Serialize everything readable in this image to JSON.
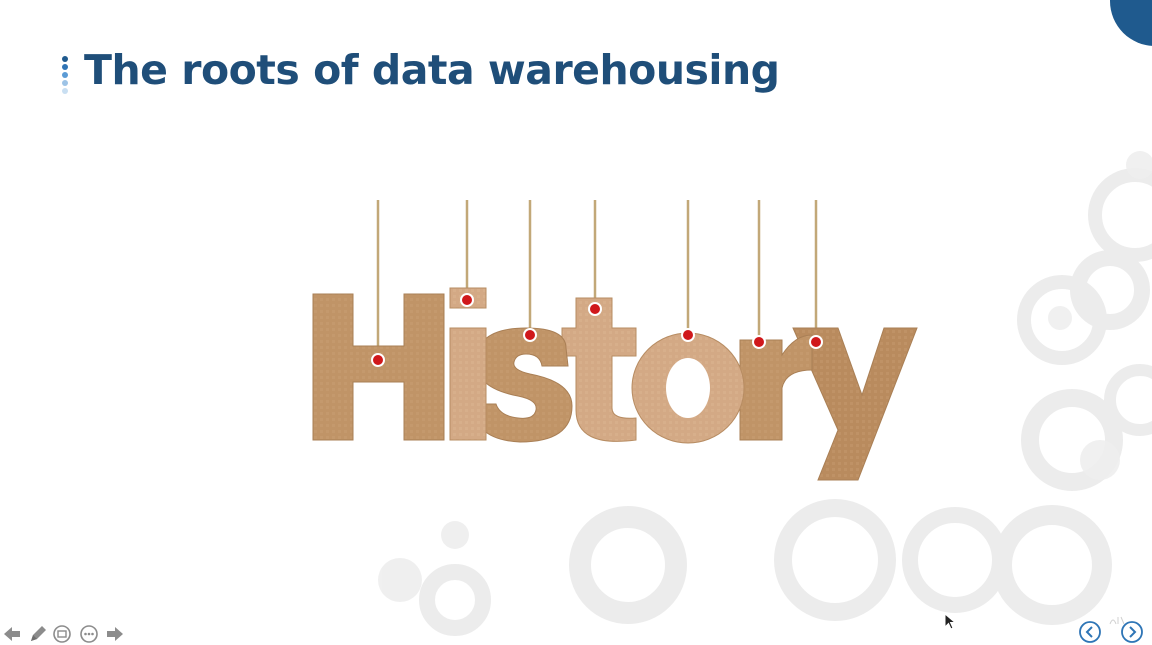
{
  "slide": {
    "title": "The roots of data warehousing",
    "graphic": {
      "word": "History",
      "letters": [
        "H",
        "i",
        "s",
        "t",
        "o",
        "r",
        "y"
      ]
    }
  },
  "icons": {
    "title_bullets": "vertical-dots-icon",
    "toolbar": [
      "arrow-left-icon",
      "pen-icon",
      "slides-icon",
      "more-icon",
      "arrow-right-icon"
    ],
    "nav": [
      "previous-slide-icon",
      "next-slide-icon"
    ]
  },
  "colors": {
    "title": "#1f4e79",
    "accent": "#1f5a8e",
    "cardboard": "#c49a6c",
    "string": "#c2a878",
    "pin": "#d0181b",
    "nav": "#2e75b6"
  }
}
